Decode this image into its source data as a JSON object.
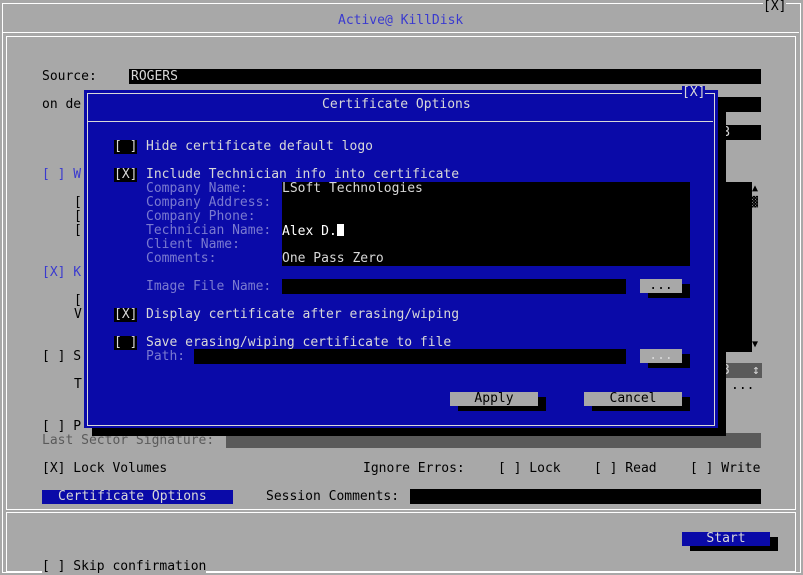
{
  "window": {
    "title": "Active@ KillDisk",
    "close_glyph": "[X]"
  },
  "main": {
    "source_label": "Source:",
    "source_value": "ROGERS",
    "on_device_label": "on de",
    "hidden_b": "B",
    "check_w_prefix": "[ ] W",
    "check_k_prefix": "[X] K",
    "check_s_prefix": "[ ] S",
    "check_p_prefix": "[ ] P",
    "letter_v": "V",
    "letter_t": "T",
    "bracket": "[",
    "num_3": "3",
    "updown_glyph": "↕",
    "dots": "...",
    "last_sector_label": "Last Sector Signature:",
    "lock_volumes": "[X] Lock Volumes",
    "ignore_errors_label": "Ignore Erros:",
    "ignore_lock": "[ ] Lock",
    "ignore_read": "[ ] Read",
    "ignore_write": "[ ] Write",
    "certificate_options_button": "Certificate Options",
    "session_comments_label": "Session Comments:",
    "start_button": "Start",
    "skip_confirmation": "[ ] Skip confirmation"
  },
  "dialog": {
    "title": "Certificate Options",
    "close_glyph": "[X]",
    "hide_logo_check": "[ ]",
    "hide_logo_label": "Hide certificate default logo",
    "include_tech_check": "[X]",
    "include_tech_label": "Include Technician info into certificate",
    "company_name_label": "Company Name:",
    "company_name_value": "LSoft Technologies",
    "company_address_label": "Company Address:",
    "company_address_value": "",
    "company_phone_label": "Company Phone:",
    "company_phone_value": "",
    "technician_name_label": "Technician Name:",
    "technician_name_value": "Alex D.",
    "client_name_label": "Client Name:",
    "client_name_value": "",
    "comments_label": "Comments:",
    "comments_value": "One Pass Zero",
    "image_file_label": "Image File Name:",
    "browse_label": "...",
    "display_cert_check": "[X]",
    "display_cert_label": "Display certificate after erasing/wiping",
    "save_cert_check": "[ ]",
    "save_cert_label": "Save erasing/wiping certificate to file",
    "path_label": "Path:",
    "path_browse_label": "...",
    "apply_button": "Apply",
    "cancel_button": "Cancel"
  },
  "colors": {
    "background": "#a8a8a8",
    "dialog_blue": "#0a0aa8",
    "title_blue": "#3a3acf",
    "field_black": "#000000"
  }
}
